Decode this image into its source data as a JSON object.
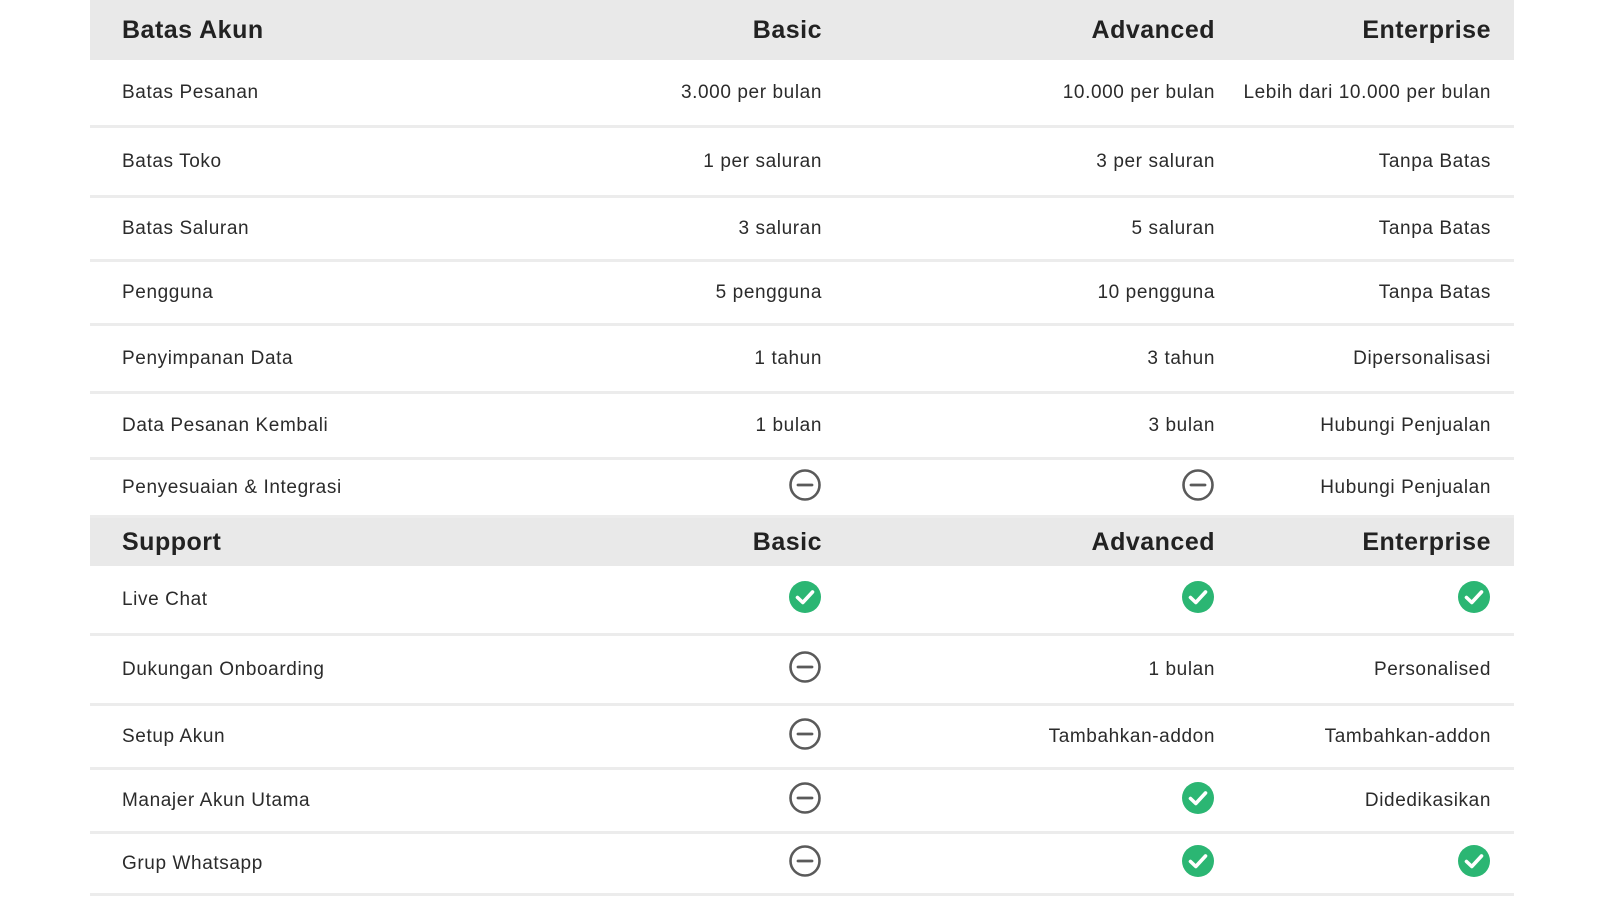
{
  "sections": [
    {
      "id": "account",
      "header": [
        "Batas Akun",
        "Basic",
        "Advanced",
        "Enterprise"
      ],
      "rows": [
        {
          "label": "Batas Pesanan",
          "cells": [
            {
              "type": "text",
              "value": "3.000 per bulan"
            },
            {
              "type": "text",
              "value": "10.000 per bulan"
            },
            {
              "type": "text",
              "value": "Lebih dari 10.000 per bulan"
            }
          ]
        },
        {
          "label": "Batas Toko",
          "cells": [
            {
              "type": "text",
              "value": "1 per saluran"
            },
            {
              "type": "text",
              "value": "3 per saluran"
            },
            {
              "type": "text",
              "value": "Tanpa Batas"
            }
          ]
        },
        {
          "label": "Batas Saluran",
          "cells": [
            {
              "type": "text",
              "value": "3 saluran"
            },
            {
              "type": "text",
              "value": "5 saluran"
            },
            {
              "type": "text",
              "value": "Tanpa Batas"
            }
          ]
        },
        {
          "label": "Pengguna",
          "cells": [
            {
              "type": "text",
              "value": "5 pengguna"
            },
            {
              "type": "text",
              "value": "10 pengguna"
            },
            {
              "type": "text",
              "value": "Tanpa Batas"
            }
          ]
        },
        {
          "label": "Penyimpanan Data",
          "cells": [
            {
              "type": "text",
              "value": "1 tahun"
            },
            {
              "type": "text",
              "value": "3 tahun"
            },
            {
              "type": "text",
              "value": "Dipersonalisasi"
            }
          ]
        },
        {
          "label": "Data Pesanan Kembali",
          "cells": [
            {
              "type": "text",
              "value": "1 bulan"
            },
            {
              "type": "text",
              "value": "3 bulan"
            },
            {
              "type": "text",
              "value": "Hubungi Penjualan"
            }
          ]
        },
        {
          "label": "Penyesuaian & Integrasi",
          "cells": [
            {
              "type": "icon",
              "icon": "minus-circle-icon"
            },
            {
              "type": "icon",
              "icon": "minus-circle-icon"
            },
            {
              "type": "text",
              "value": "Hubungi Penjualan"
            }
          ]
        }
      ]
    },
    {
      "id": "support",
      "header": [
        "Support",
        "Basic",
        "Advanced",
        "Enterprise"
      ],
      "rows": [
        {
          "label": "Live Chat",
          "cells": [
            {
              "type": "icon",
              "icon": "check-circle-icon"
            },
            {
              "type": "icon",
              "icon": "check-circle-icon"
            },
            {
              "type": "icon",
              "icon": "check-circle-icon"
            }
          ]
        },
        {
          "label": "Dukungan Onboarding",
          "cells": [
            {
              "type": "icon",
              "icon": "minus-circle-icon"
            },
            {
              "type": "text",
              "value": "1 bulan"
            },
            {
              "type": "text",
              "value": "Personalised"
            }
          ]
        },
        {
          "label": "Setup Akun",
          "cells": [
            {
              "type": "icon",
              "icon": "minus-circle-icon"
            },
            {
              "type": "text",
              "value": "Tambahkan-addon"
            },
            {
              "type": "text",
              "value": "Tambahkan-addon"
            }
          ]
        },
        {
          "label": "Manajer Akun Utama",
          "cells": [
            {
              "type": "icon",
              "icon": "minus-circle-icon"
            },
            {
              "type": "icon",
              "icon": "check-circle-icon"
            },
            {
              "type": "text",
              "value": "Didedikasikan"
            }
          ]
        },
        {
          "label": "Grup Whatsapp",
          "cells": [
            {
              "type": "icon",
              "icon": "minus-circle-icon"
            },
            {
              "type": "icon",
              "icon": "check-circle-icon"
            },
            {
              "type": "icon",
              "icon": "check-circle-icon"
            }
          ]
        }
      ]
    }
  ],
  "colors": {
    "header_bg": "#e9e9e9",
    "check_green": "#2bb673",
    "minus_gray": "#5a5a5a",
    "divider": "#ececec"
  }
}
